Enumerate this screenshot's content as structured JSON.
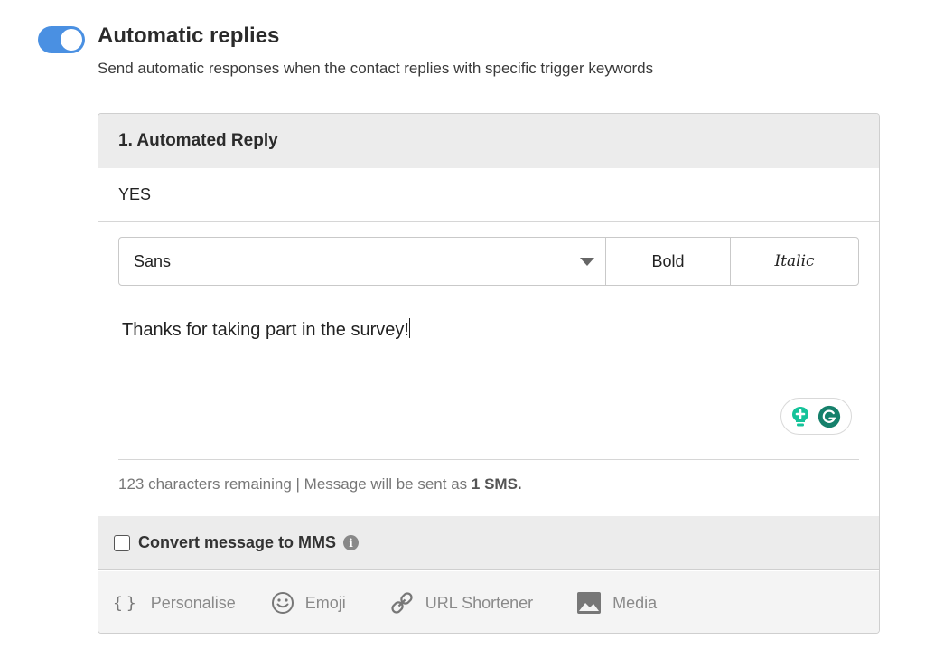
{
  "header": {
    "toggle_on": true,
    "title": "Automatic replies",
    "subtitle": "Send automatic responses when the contact replies with specific trigger keywords"
  },
  "reply": {
    "heading": "1. Automated Reply",
    "keyword": "YES",
    "toolbar": {
      "font_value": "Sans",
      "bold_label": "Bold",
      "italic_label": "Italic"
    },
    "message": "Thanks for taking part in the survey!",
    "counter": {
      "text": "123 characters remaining | Message will be sent as ",
      "sms": "1 SMS."
    },
    "mms": {
      "label": "Convert message to MMS",
      "checked": false,
      "info_icon": "info-icon"
    },
    "tools": [
      {
        "icon": "braces-icon",
        "label": "Personalise"
      },
      {
        "icon": "emoji-icon",
        "label": "Emoji"
      },
      {
        "icon": "link-icon",
        "label": "URL Shortener"
      },
      {
        "icon": "image-icon",
        "label": "Media"
      }
    ]
  },
  "colors": {
    "toggle": "#4a90e2",
    "grammarly": "#15c39a",
    "header_bg": "#ececec"
  }
}
